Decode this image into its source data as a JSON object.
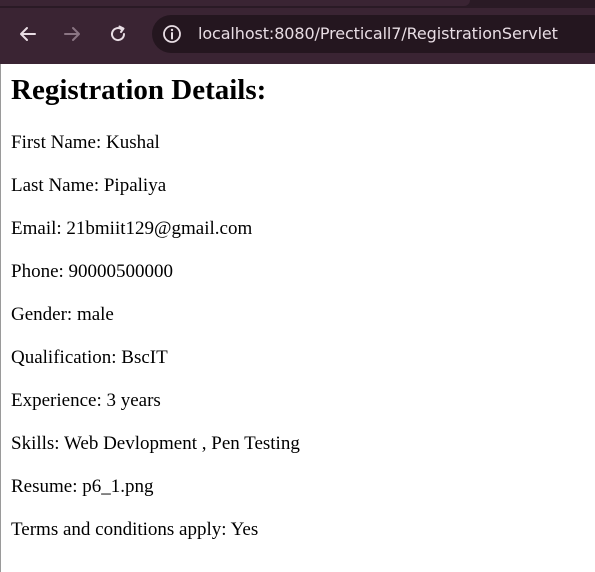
{
  "browser": {
    "url": "localhost:8080/Precticall7/RegistrationServlet"
  },
  "page": {
    "title": "Registration Details:",
    "details": [
      "First Name: Kushal",
      "Last Name: Pipaliya",
      "Email: 21bmiit129@gmail.com",
      "Phone: 90000500000",
      "Gender: male",
      "Qualification: BscIT",
      "Experience: 3 years",
      "Skills: Web Devlopment , Pen Testing",
      "Resume: p6_1.png",
      "Terms and conditions apply: Yes"
    ]
  }
}
